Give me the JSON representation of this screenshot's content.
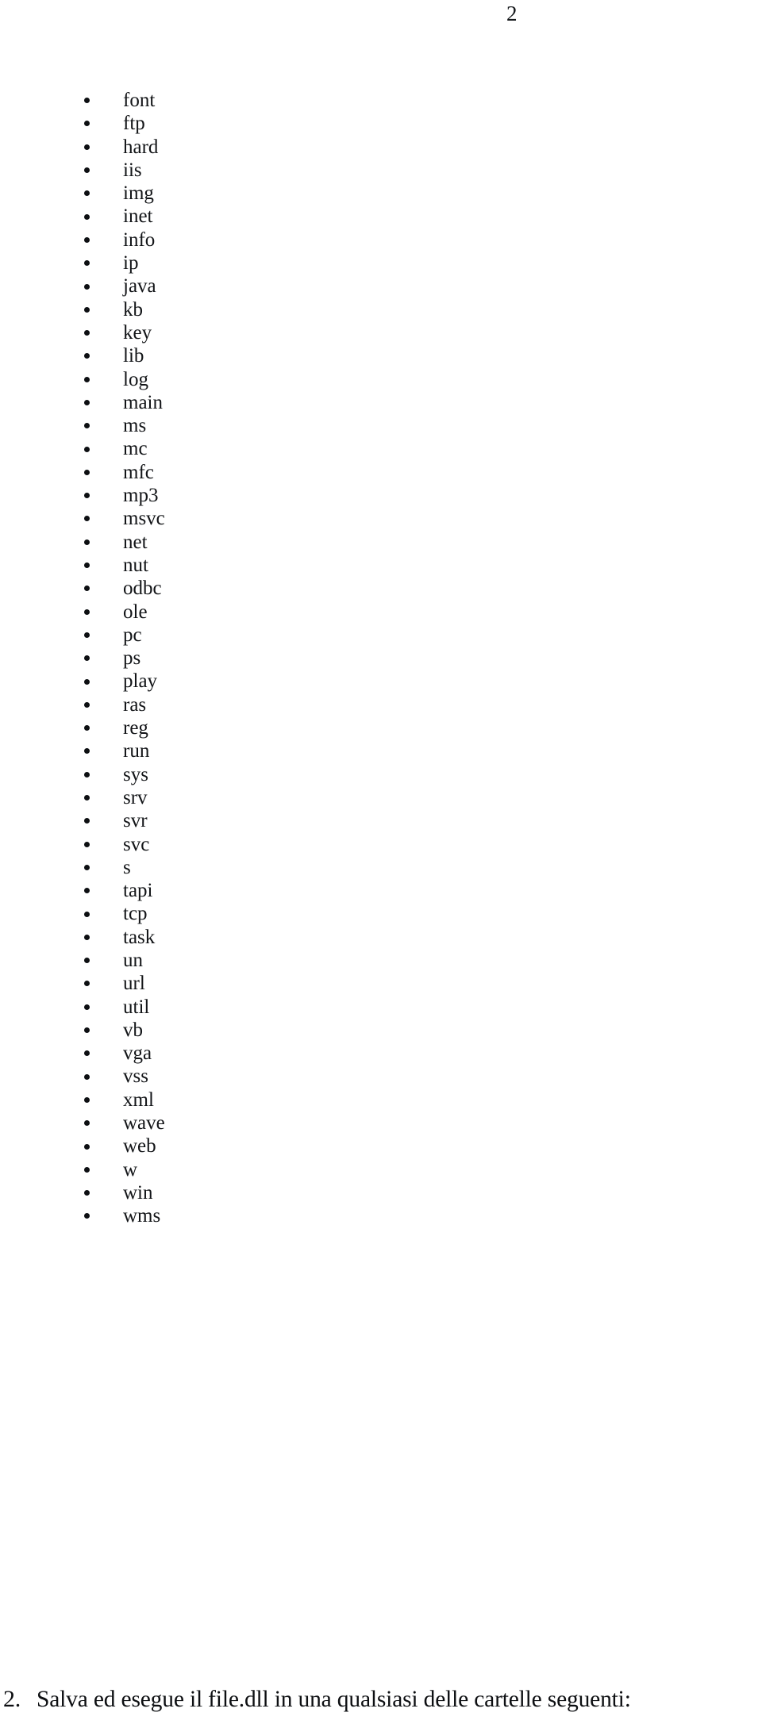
{
  "page": {
    "number": "2",
    "background_color": "#ffffff",
    "text_color": "#121417"
  },
  "folder_list": {
    "bullet_glyph": "•",
    "items": [
      {
        "label": "font"
      },
      {
        "label": "ftp"
      },
      {
        "label": "hard"
      },
      {
        "label": "iis"
      },
      {
        "label": "img"
      },
      {
        "label": "inet"
      },
      {
        "label": "info"
      },
      {
        "label": "ip"
      },
      {
        "label": "java"
      },
      {
        "label": "kb"
      },
      {
        "label": "key"
      },
      {
        "label": "lib"
      },
      {
        "label": "log"
      },
      {
        "label": "main"
      },
      {
        "label": "ms"
      },
      {
        "label": "mc"
      },
      {
        "label": "mfc"
      },
      {
        "label": "mp3"
      },
      {
        "label": "msvc"
      },
      {
        "label": "net"
      },
      {
        "label": "nut"
      },
      {
        "label": "odbc"
      },
      {
        "label": "ole"
      },
      {
        "label": "pc"
      },
      {
        "label": "ps"
      },
      {
        "label": "play"
      },
      {
        "label": "ras"
      },
      {
        "label": "reg"
      },
      {
        "label": "run"
      },
      {
        "label": "sys"
      },
      {
        "label": "srv"
      },
      {
        "label": "svr"
      },
      {
        "label": "svc"
      },
      {
        "label": "s"
      },
      {
        "label": "tapi"
      },
      {
        "label": "tcp"
      },
      {
        "label": "task"
      },
      {
        "label": "un"
      },
      {
        "label": "url"
      },
      {
        "label": "util"
      },
      {
        "label": "vb"
      },
      {
        "label": "vga"
      },
      {
        "label": "vss"
      },
      {
        "label": "xml"
      },
      {
        "label": "wave"
      },
      {
        "label": "web"
      },
      {
        "label": "w"
      },
      {
        "label": "win"
      },
      {
        "label": "wms"
      }
    ]
  },
  "step": {
    "number": "2.",
    "text": "Salva ed esegue il file.dll in una qualsiasi delle cartelle seguenti:"
  }
}
